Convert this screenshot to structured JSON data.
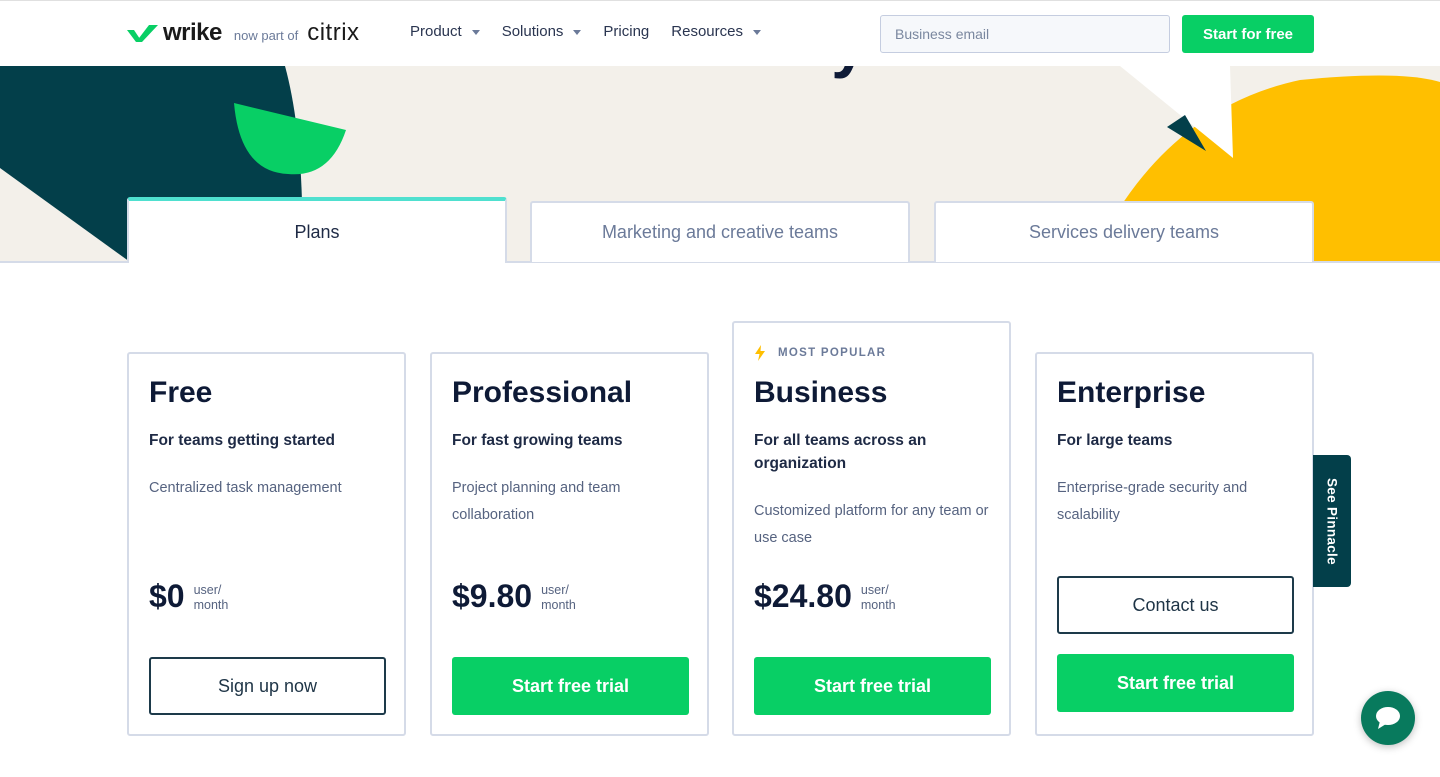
{
  "brand": {
    "name": "wrike",
    "subtitle": "now part of",
    "partner": "citrix",
    "accent": "#08cf65",
    "dark": "#033f4a",
    "yellow": "#ffbf00",
    "tab_accent": "#4fe0cf"
  },
  "nav": {
    "items": [
      {
        "label": "Product",
        "dropdown": true
      },
      {
        "label": "Solutions",
        "dropdown": true
      },
      {
        "label": "Pricing",
        "dropdown": false
      },
      {
        "label": "Resources",
        "dropdown": true
      }
    ],
    "email_placeholder": "Business email",
    "email_value": "",
    "cta": "Start for free"
  },
  "hero": {
    "title": "Plans for Every Team"
  },
  "tabs": [
    {
      "label": "Plans",
      "active": true
    },
    {
      "label": "Marketing and creative teams",
      "active": false
    },
    {
      "label": "Services delivery teams",
      "active": false
    }
  ],
  "plans": [
    {
      "name": "Free",
      "tagline": "For teams getting started",
      "description": "Centralized task management",
      "price": "$0",
      "unit_line1": "user/",
      "unit_line2": "month",
      "buttons": [
        {
          "label": "Sign up now",
          "style": "outline"
        }
      ]
    },
    {
      "name": "Professional",
      "tagline": "For fast growing teams",
      "description": "Project planning and team collaboration",
      "price": "$9.80",
      "unit_line1": "user/",
      "unit_line2": "month",
      "buttons": [
        {
          "label": "Start free trial",
          "style": "green"
        }
      ]
    },
    {
      "badge": "MOST POPULAR",
      "badge_icon": "lightning-bolt-icon",
      "name": "Business",
      "tagline": "For all teams across an organization",
      "description": "Customized platform for any team or use case",
      "price": "$24.80",
      "unit_line1": "user/",
      "unit_line2": "month",
      "buttons": [
        {
          "label": "Start free trial",
          "style": "green"
        }
      ]
    },
    {
      "name": "Enterprise",
      "tagline": "For large teams",
      "description": "Enterprise-grade security and scalability",
      "buttons": [
        {
          "label": "Contact us",
          "style": "outline"
        },
        {
          "label": "Start free trial",
          "style": "green"
        }
      ]
    }
  ],
  "side_tab": {
    "label": "See Pinnacle"
  },
  "chat": {
    "icon": "chat-bubble-icon"
  }
}
